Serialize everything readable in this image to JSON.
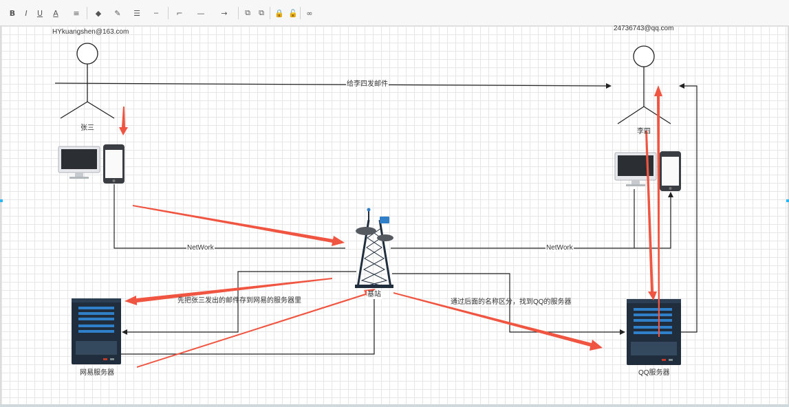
{
  "toolbar": {
    "bold": "B",
    "italic": "I",
    "underline": "U",
    "font_color": "A",
    "align": "≡",
    "fill": "◆",
    "line_color": "✎",
    "line_width": "☰",
    "line_dash": "┄",
    "waypoint": "⌐",
    "line_style": "—",
    "arrow": "→",
    "to_front": "⧉",
    "to_back": "⧉",
    "lock": "🔒",
    "unlock": "🔓",
    "link": "∞"
  },
  "diagram": {
    "sender_email": "HYkuangshen@163.com",
    "receiver_email": "24736743@qq.com",
    "sender_name": "张三",
    "receiver_name": "李四",
    "send_label": "给李四发邮件",
    "network_left": "NetWork",
    "network_right": "NetWork",
    "tower_label": "基站",
    "store_note": "先把张三发出的邮件存到网易的服务器里",
    "route_note": "通过后面的名称区分，找到QQ的服务器",
    "netease_server": "网易服务器",
    "qq_server": "QQ服务器"
  },
  "colors": {
    "annotation_arrow": "#f05541",
    "connector": "#222222",
    "server_body": "#1f2d3d",
    "server_slot": "#2f80c9"
  }
}
